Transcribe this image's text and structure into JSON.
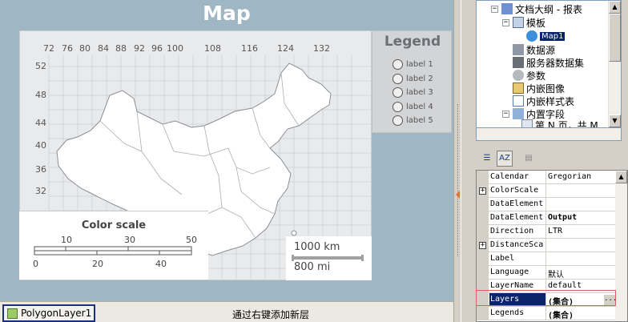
{
  "map": {
    "title": "Map",
    "longitude_ticks": [
      "72",
      "76",
      "80",
      "84",
      "88",
      "92",
      "96",
      "100",
      "108",
      "116",
      "124",
      "132"
    ],
    "latitude_ticks": [
      "52",
      "48",
      "44",
      "40",
      "36",
      "32"
    ],
    "legend": {
      "title": "Legend",
      "items": [
        "label 1",
        "label 2",
        "label 3",
        "label 4",
        "label 5"
      ]
    },
    "color_scale": {
      "title": "Color scale",
      "top_ticks": [
        "10",
        "30",
        "50"
      ],
      "bottom_ticks": [
        "0",
        "20",
        "40"
      ]
    },
    "distance_scale": {
      "km": "1000 km",
      "mi": "800 mi"
    },
    "colors": {
      "background": "#9fb6c5",
      "map_fill": "#ffffff",
      "frame": "#e9eaec"
    }
  },
  "layers": {
    "tab_label": "PolygonLayer1",
    "hint": "通过右键添加新层"
  },
  "tree": {
    "items": [
      {
        "label": "文档大纲 - 报表",
        "icon": "document-outline-icon"
      },
      {
        "label": "模板",
        "icon": "template-icon"
      },
      {
        "label": "Map1",
        "icon": "globe-icon"
      },
      {
        "label": "数据源",
        "icon": "datasource-icon"
      },
      {
        "label": "服务器数据集",
        "icon": "dataset-icon"
      },
      {
        "label": "参数",
        "icon": "parameter-icon"
      },
      {
        "label": "内嵌图像",
        "icon": "image-icon"
      },
      {
        "label": "内嵌样式表",
        "icon": "stylesheet-icon"
      },
      {
        "label": "内置字段",
        "icon": "field-icon"
      },
      {
        "label": "第 N 页，共 M",
        "icon": "page-icon"
      }
    ]
  },
  "toolbar": {
    "categorized": "categorized-icon",
    "alphabetical": "AZ",
    "property_pages": "property-pages-icon"
  },
  "properties": [
    {
      "name": "Calendar",
      "value": "Gregorian"
    },
    {
      "name": "ColorScale",
      "value": ""
    },
    {
      "name": "DataElement",
      "value": ""
    },
    {
      "name": "DataElement",
      "value": "Output"
    },
    {
      "name": "Direction",
      "value": "LTR"
    },
    {
      "name": "DistanceSca",
      "value": ""
    },
    {
      "name": "Label",
      "value": ""
    },
    {
      "name": "Language",
      "value": "默认"
    },
    {
      "name": "LayerName",
      "value": "default"
    },
    {
      "name": "Layers",
      "value": "(集合)"
    },
    {
      "name": "Legends",
      "value": "(集合)"
    }
  ],
  "ellipsis": "..."
}
